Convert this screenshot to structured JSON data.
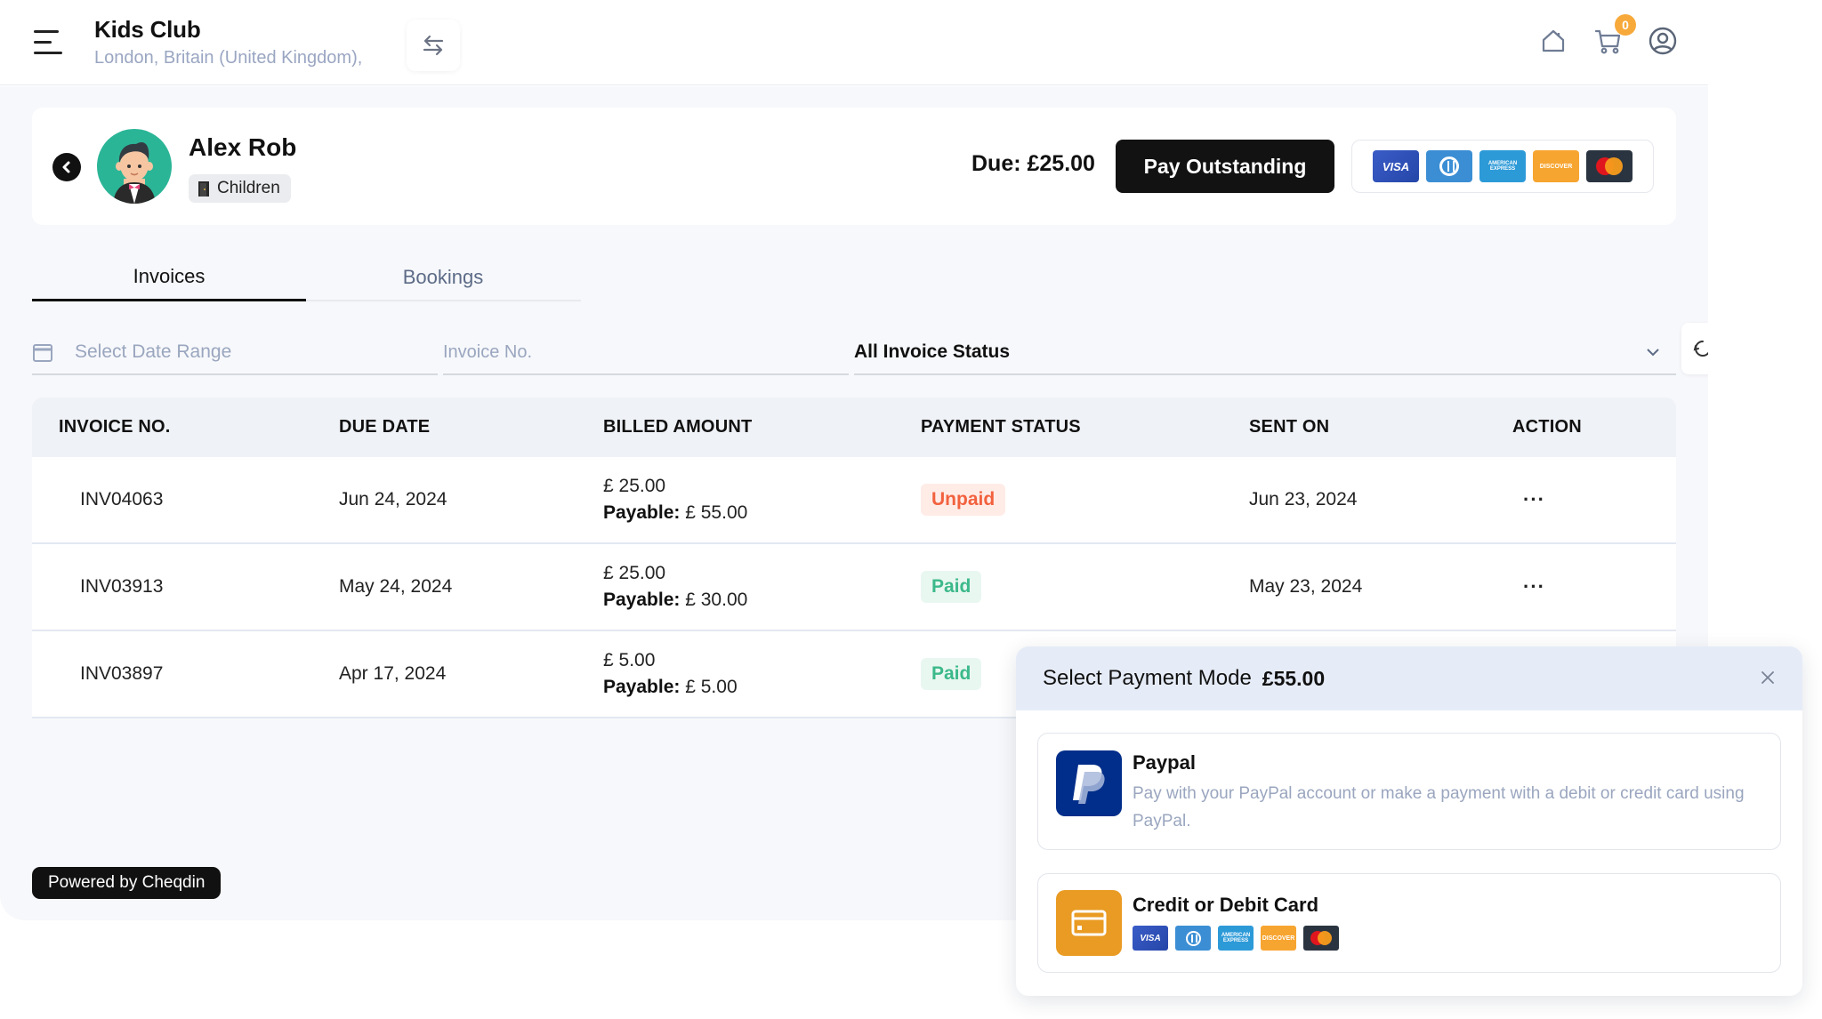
{
  "header": {
    "org_name": "Kids Club",
    "org_location": "London, Britain (United Kingdom),",
    "cart_count": "0",
    "icons": [
      "menu-icon",
      "switch-icon",
      "home-icon",
      "cart-icon",
      "user-icon"
    ]
  },
  "profile": {
    "name": "Alex Rob",
    "member_type": "Children",
    "due_label": "Due: £25.00",
    "pay_button": "Pay Outstanding",
    "accepted_cards": [
      "VISA",
      "Diners Club",
      "American Express",
      "Discover",
      "Mastercard"
    ]
  },
  "tabs": [
    {
      "label": "Invoices",
      "active": true
    },
    {
      "label": "Bookings",
      "active": false
    }
  ],
  "filters": {
    "date_placeholder": "Select Date Range",
    "invoice_placeholder": "Invoice No.",
    "status_selected": "All Invoice Status"
  },
  "table": {
    "columns": [
      "INVOICE NO.",
      "DUE DATE",
      "BILLED AMOUNT",
      "PAYMENT STATUS",
      "SENT ON",
      "ACTION"
    ],
    "payable_label": "Payable:",
    "rows": [
      {
        "invoice_no": "INV04063",
        "due_date": "Jun 24, 2024",
        "billed": "£ 25.00",
        "payable": "£ 55.00",
        "status": "Unpaid",
        "sent_on": "Jun 23, 2024",
        "action": "···"
      },
      {
        "invoice_no": "INV03913",
        "due_date": "May 24, 2024",
        "billed": "£ 25.00",
        "payable": "£ 30.00",
        "status": "Paid",
        "sent_on": "May 23, 2024",
        "action": "···"
      },
      {
        "invoice_no": "INV03897",
        "due_date": "Apr 17, 2024",
        "billed": "£ 5.00",
        "payable": "£ 5.00",
        "status": "Paid",
        "sent_on": "",
        "action": ""
      }
    ]
  },
  "footer": {
    "powered_by": "Powered by Cheqdin"
  },
  "payment_modal": {
    "title": "Select Payment Mode",
    "amount": "£55.00",
    "options": [
      {
        "name": "Paypal",
        "description": "Pay with your PayPal account or make a payment with a debit or credit card using PayPal."
      },
      {
        "name": "Credit or Debit Card",
        "cards": [
          "VISA",
          "Diners Club",
          "American Express",
          "Discover",
          "Mastercard"
        ]
      }
    ]
  },
  "colors": {
    "accent_dark": "#121212",
    "unpaid": "#f2613e",
    "paid": "#3cb98a",
    "badge": "#f7a93a",
    "paypal_blue": "#012e8a",
    "card_orange": "#e99b23",
    "avatar_bg": "#2bb597"
  }
}
